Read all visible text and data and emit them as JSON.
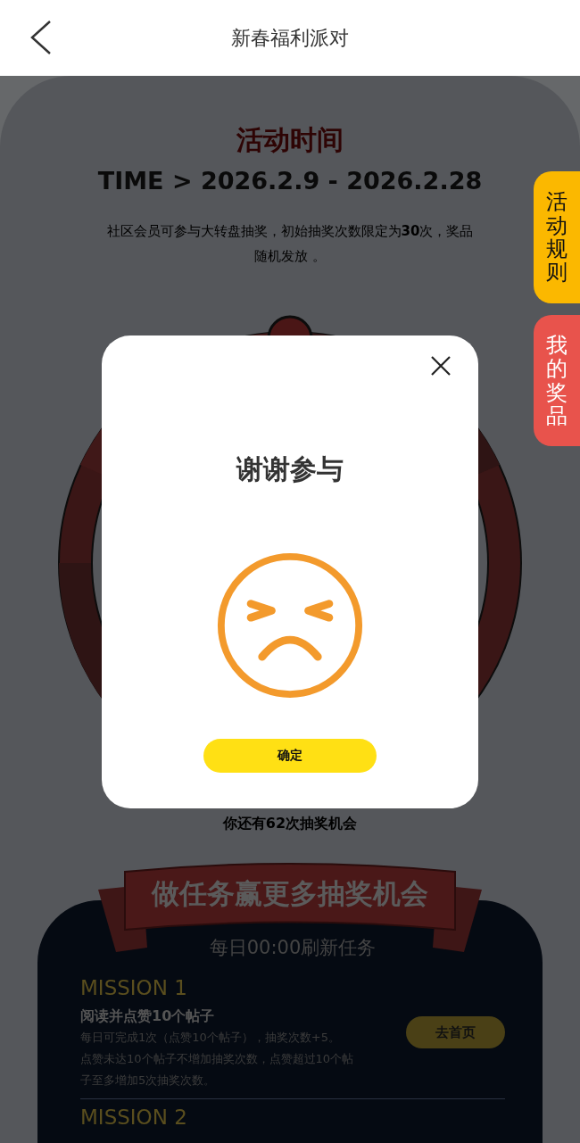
{
  "header": {
    "title": "新春福利派对"
  },
  "event": {
    "heading": "活动时间",
    "time": "TIME > 2026.2.9 - 2026.2.28",
    "description": "社区会员可参与大转盘抽奖，初始抽奖次数限定为**30**次，奖品随机发放 。"
  },
  "side_tabs": [
    {
      "label": "活动规则",
      "kind": "rules"
    },
    {
      "label": "我的奖品",
      "kind": "prizes"
    }
  ],
  "draws_left": "你还有62次抽奖机会",
  "tasks": {
    "banner": "做任务赢更多抽奖机会",
    "refresh_note": "每日00:00刷新任务",
    "missions": [
      {
        "label": "MISSION 1",
        "title": "阅读并点赞10个帖子",
        "details": [
          "每日可完成1次（点赞10个帖子），抽奖次数+5。",
          "点赞未达10个帖子不增加抽奖次数，点赞超过10个帖子至多增加5次抽奖次数。"
        ],
        "button": "去首页"
      },
      {
        "label": "MISSION 2"
      }
    ]
  },
  "dialog": {
    "title": "谢谢参与",
    "button": "确定"
  }
}
